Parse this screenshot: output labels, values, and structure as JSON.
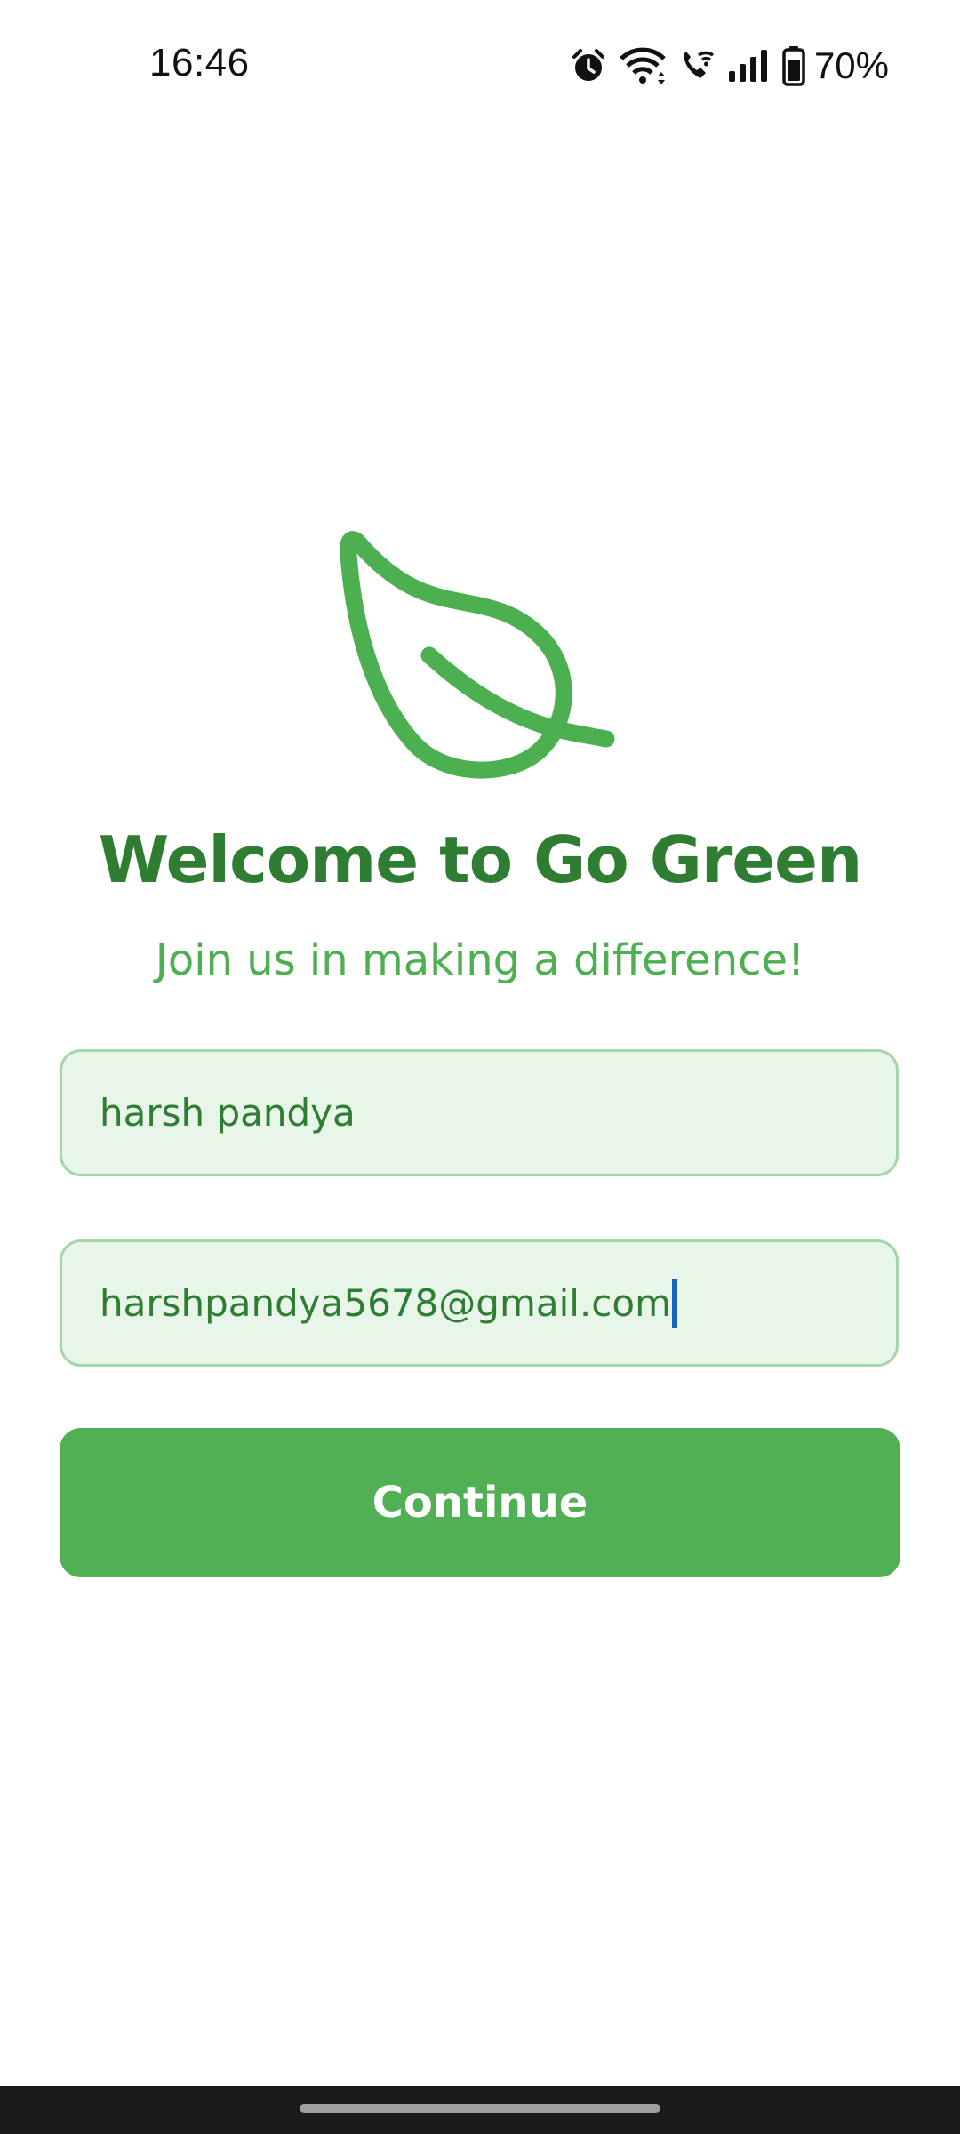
{
  "status_bar": {
    "time": "16:46",
    "battery_percent": "70%",
    "icons": [
      "alarm-icon",
      "wifi-icon",
      "wifi-calling-icon",
      "signal-icon",
      "battery-icon"
    ]
  },
  "app": {
    "logo_icon": "leaf-icon",
    "title": "Welcome to Go Green",
    "subtitle": "Join us in making a difference!"
  },
  "form": {
    "name_value": "harsh pandya",
    "email_value": "harshpandya5678@gmail.com",
    "continue_label": "Continue"
  },
  "colors": {
    "primary_green": "#4caf50",
    "dark_green": "#2e7d32",
    "field_background": "#e8f5e9",
    "field_border": "#a5d6a7",
    "caret": "#1565c0"
  }
}
